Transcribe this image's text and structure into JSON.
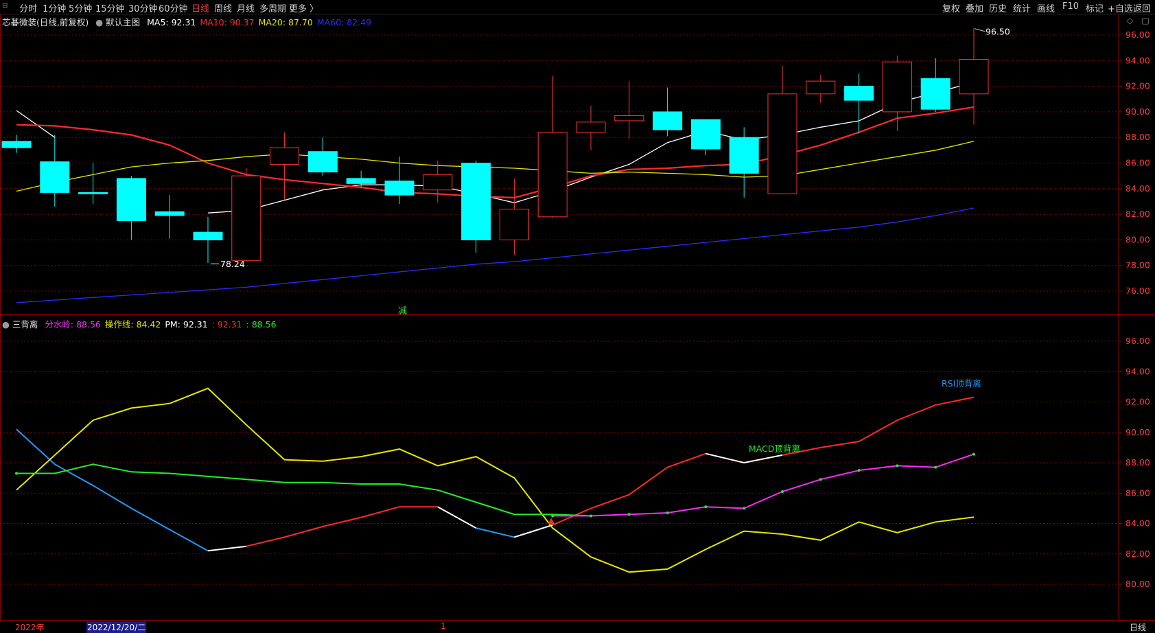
{
  "toolbar": {
    "left": [
      "分时",
      "1分钟",
      "5分钟",
      "15分钟",
      "30分钟",
      "60分钟",
      "日线",
      "周线",
      "月线",
      "多周期",
      "更多 〉"
    ],
    "active": "日线",
    "right": [
      "复权",
      "叠加",
      "历史",
      "统计",
      "画线",
      "F10",
      "标记",
      "+自选",
      "返回"
    ]
  },
  "main_info": {
    "title": "芯碁微装(日线,前复权)",
    "template": "默认主图",
    "ma": [
      {
        "label": "MA5: 92.31",
        "color": "#ffffff"
      },
      {
        "label": "MA10: 90.37",
        "color": "#ff2a2a"
      },
      {
        "label": "MA20: 87.70",
        "color": "#e6e600"
      },
      {
        "label": "MA60: 82.49",
        "color": "#2b2bff"
      }
    ]
  },
  "sub_info": {
    "title": "三背离",
    "items": [
      {
        "label": "分水岭: 88.56",
        "color": "#ff2aff"
      },
      {
        "label": "操作线: 84.42",
        "color": "#e6e600"
      },
      {
        "label": "PM: 92.31",
        "color": "#ffffff"
      },
      {
        "label": ": 92.31",
        "color": "#ff2a2a"
      },
      {
        "label": ": 88.56",
        "color": "#22ee22"
      }
    ]
  },
  "annotations": {
    "high": "96.50",
    "low": "78.24",
    "jian": "减",
    "rsi": "RSI顶背离",
    "macd": "MACD顶背离"
  },
  "bottom": {
    "year": "2022年",
    "date": "2022/12/20/二",
    "tick": "1",
    "period": "日线"
  },
  "colors": {
    "up": "#ff3232",
    "down": "#00ffff",
    "grid": "#8b0000",
    "axis": "#ff3b3b"
  },
  "chart_data": [
    {
      "type": "candlestick",
      "title": "芯碁微装(日线,前复权)",
      "y_ticks": [
        76.0,
        78.0,
        80.0,
        82.0,
        84.0,
        86.0,
        88.0,
        90.0,
        92.0,
        94.0,
        96.0
      ],
      "ylim": [
        74.8,
        97.0
      ],
      "ohlc": [
        [
          87.7,
          88.2,
          86.8,
          87.2
        ],
        [
          86.1,
          88.2,
          82.6,
          83.7
        ],
        [
          83.7,
          86.0,
          82.8,
          83.6
        ],
        [
          84.8,
          85.0,
          80.0,
          81.5
        ],
        [
          82.2,
          83.5,
          80.1,
          81.9
        ],
        [
          80.6,
          81.8,
          78.2,
          80.0
        ],
        [
          78.4,
          85.6,
          78.3,
          85.0
        ],
        [
          85.9,
          88.4,
          83.1,
          87.2
        ],
        [
          86.9,
          88.0,
          85.0,
          85.3
        ],
        [
          84.8,
          85.4,
          84.1,
          84.4
        ],
        [
          84.6,
          86.5,
          82.8,
          83.5
        ],
        [
          83.9,
          86.2,
          82.9,
          85.1
        ],
        [
          86.0,
          86.2,
          79.0,
          80.0
        ],
        [
          80.0,
          84.8,
          78.8,
          82.4
        ],
        [
          81.8,
          92.8,
          81.7,
          88.4
        ],
        [
          88.4,
          90.5,
          87.0,
          89.2
        ],
        [
          89.3,
          92.4,
          87.9,
          89.7
        ],
        [
          90.0,
          91.9,
          88.1,
          88.6
        ],
        [
          89.4,
          89.4,
          86.6,
          87.1
        ],
        [
          88.0,
          88.8,
          83.3,
          85.2
        ],
        [
          83.6,
          93.6,
          83.6,
          91.4
        ],
        [
          91.4,
          92.9,
          90.7,
          92.4
        ],
        [
          92.0,
          93.0,
          88.3,
          90.9
        ],
        [
          90.0,
          94.4,
          88.5,
          93.9
        ],
        [
          92.6,
          94.2,
          90.0,
          90.2
        ],
        [
          91.4,
          96.5,
          89.0,
          94.1
        ]
      ],
      "series": [
        {
          "name": "MA5",
          "color": "#ffffff",
          "values": [
            90.1,
            88.0,
            null,
            null,
            null,
            82.1,
            82.3,
            83.1,
            83.9,
            84.3,
            84.3,
            84.2,
            83.6,
            82.9,
            83.8,
            84.9,
            85.9,
            87.6,
            88.5,
            87.8,
            88.2,
            88.8,
            89.3,
            90.7,
            91.5,
            92.3
          ]
        },
        {
          "name": "MA10",
          "color": "#ff2a2a",
          "values": [
            89.0,
            88.9,
            88.6,
            88.2,
            87.4,
            86.0,
            85.1,
            84.7,
            84.4,
            84.1,
            83.7,
            83.6,
            83.4,
            83.3,
            84.1,
            85.0,
            85.5,
            85.6,
            85.8,
            85.9,
            86.6,
            87.4,
            88.4,
            89.5,
            89.9,
            90.37
          ]
        },
        {
          "name": "MA20",
          "color": "#e6e600",
          "values": [
            83.8,
            84.5,
            85.1,
            85.7,
            86.0,
            86.2,
            86.5,
            86.7,
            86.5,
            86.3,
            86.0,
            85.8,
            85.7,
            85.6,
            85.4,
            85.2,
            85.3,
            85.2,
            85.1,
            84.9,
            85.0,
            85.5,
            86.0,
            86.5,
            87.0,
            87.7
          ]
        },
        {
          "name": "MA60",
          "color": "#2b2bff",
          "values": [
            75.1,
            75.3,
            75.5,
            75.7,
            75.9,
            76.1,
            76.3,
            76.6,
            76.9,
            77.2,
            77.5,
            77.8,
            78.1,
            78.3,
            78.6,
            78.9,
            79.2,
            79.5,
            79.8,
            80.1,
            80.4,
            80.7,
            81.0,
            81.4,
            81.9,
            82.49
          ]
        }
      ]
    },
    {
      "type": "line",
      "title": "三背离",
      "y_ticks": [
        80.0,
        82.0,
        84.0,
        86.0,
        88.0,
        90.0,
        92.0,
        94.0,
        96.0
      ],
      "ylim": [
        79.0,
        96.9
      ],
      "series": [
        {
          "name": "分水岭",
          "color": "#ff2aff",
          "values": [
            null,
            null,
            null,
            null,
            null,
            null,
            null,
            null,
            null,
            null,
            null,
            null,
            null,
            null,
            84.5,
            84.5,
            84.6,
            84.7,
            85.1,
            85.0,
            86.1,
            86.9,
            87.5,
            87.8,
            87.7,
            88.56
          ]
        },
        {
          "name": "操作线",
          "color": "#e6e600",
          "values": [
            86.2,
            88.5,
            90.8,
            91.6,
            91.9,
            92.9,
            90.5,
            88.2,
            88.1,
            88.4,
            88.9,
            87.8,
            88.4,
            87.0,
            83.7,
            81.8,
            80.8,
            81.0,
            82.3,
            83.5,
            83.3,
            82.9,
            84.1,
            83.4,
            84.1,
            84.42
          ]
        },
        {
          "name": "PM",
          "color": "#ff2a2a",
          "values": [
            90.2,
            87.9,
            86.5,
            85.0,
            83.6,
            82.2,
            82.5,
            83.1,
            83.8,
            84.4,
            85.1,
            85.1,
            83.7,
            83.1,
            83.9,
            85.0,
            85.9,
            87.7,
            88.6,
            88.0,
            88.5,
            89.0,
            89.4,
            90.8,
            91.8,
            92.31
          ]
        },
        {
          "name": "绿线",
          "color": "#22ee22",
          "values": [
            87.3,
            87.3,
            87.9,
            87.4,
            87.3,
            87.1,
            86.9,
            86.7,
            86.7,
            86.6,
            86.6,
            86.2,
            85.4,
            84.6,
            84.6,
            84.5,
            null,
            null,
            null,
            null,
            null,
            null,
            null,
            null,
            null,
            null
          ]
        }
      ]
    }
  ]
}
